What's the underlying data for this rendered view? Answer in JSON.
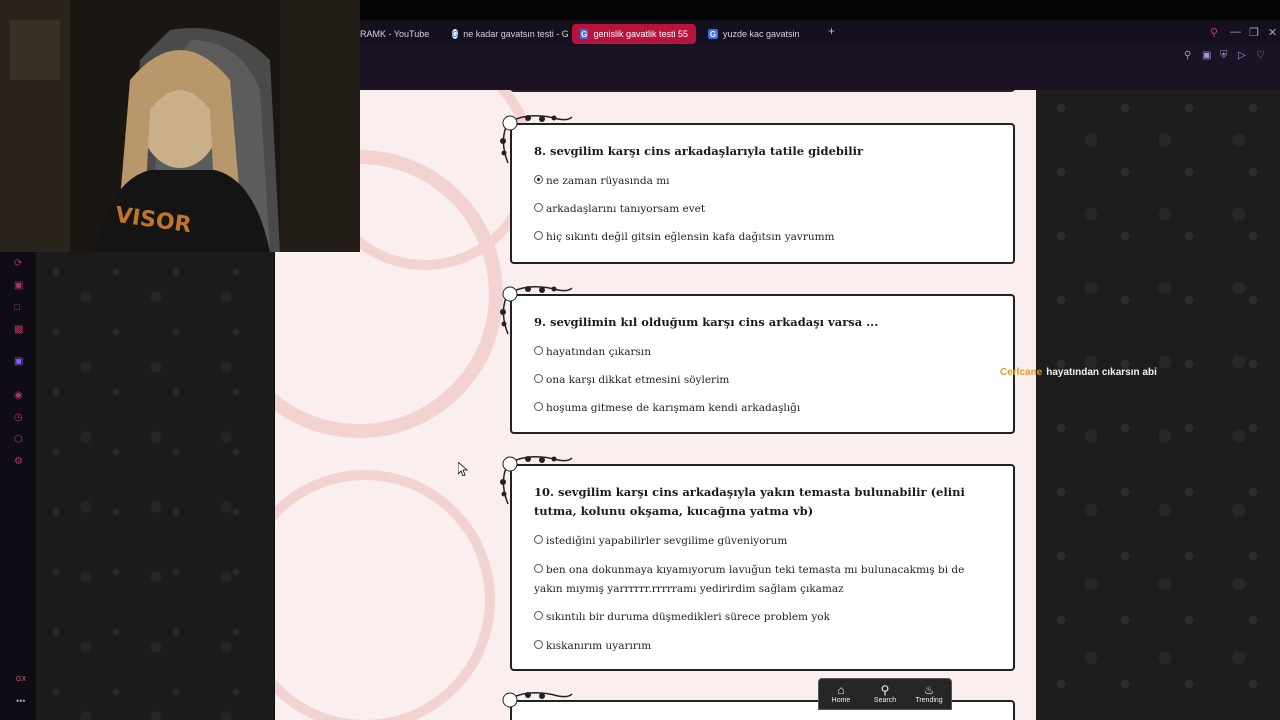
{
  "browser": {
    "tabs": [
      {
        "label": "RAMK - YouTube",
        "active": false
      },
      {
        "label": "ne kadar gavatsın testi - G",
        "active": false
      },
      {
        "label": "genislik gavatlik testi 55",
        "active": true
      },
      {
        "label": "yuzde kac gavatsin",
        "active": false
      }
    ],
    "new_tab_symbol": "+",
    "window_controls": [
      "search",
      "minimize",
      "restore",
      "close"
    ]
  },
  "quiz": {
    "questions": [
      {
        "title": "8. sevgilim karşı cins arkadaşlarıyla tatile gidebilir",
        "options": [
          {
            "label": "ne zaman rüyasında mı",
            "checked": true
          },
          {
            "label": "arkadaşlarını tanıyorsam evet",
            "checked": false
          },
          {
            "label": "hiç sıkıntı değil gitsin eğlensin kafa dağıtsın yavrumm",
            "checked": false
          }
        ]
      },
      {
        "title": "9. sevgilimin kıl olduğum karşı cins arkadaşı varsa ...",
        "options": [
          {
            "label": "hayatından çıkarsın",
            "checked": false
          },
          {
            "label": "ona karşı dikkat etmesini söylerim",
            "checked": false
          },
          {
            "label": "hoşuma gitmese de karışmam kendi arkadaşlığı",
            "checked": false
          }
        ]
      },
      {
        "title": "10. sevgilim karşı cins arkadaşıyla yakın temasta bulunabilir (elini tutma, kolunu okşama, kucağına yatma vb)",
        "options": [
          {
            "label": "istediğini yapabilirler sevgilime güveniyorum",
            "checked": false
          },
          {
            "label": "ben ona dokunmaya kıyamıyorum lavuğun teki temasta mı bulunacakmış bi de yakın mıymış yarrrrrr.rrrrramı yedirirdim sağlam çıkamaz",
            "checked": false
          },
          {
            "label": "sıkıntılı bir duruma düşmedikleri sürece problem yok",
            "checked": false
          },
          {
            "label": "kıskanırım uyarırım",
            "checked": false
          }
        ]
      }
    ]
  },
  "chat": {
    "username": "Cerlcane",
    "message": "hayatından cıkarsın abi",
    "username_color": "#e09a2a"
  },
  "bottom_nav": {
    "home": "Home",
    "search": "Search",
    "trending": "Trending"
  },
  "left_rail": {
    "label": "GX",
    "more": "•••"
  },
  "colors": {
    "accent_tab": "#b8133a",
    "page_bg": "#fbeeee",
    "pattern_bg": "#1c1c1c"
  }
}
